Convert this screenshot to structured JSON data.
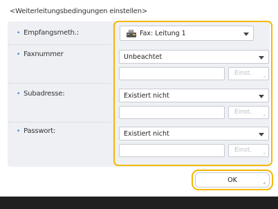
{
  "heading": "<Weiterleitungsbedingungen einstellen>",
  "rows": {
    "receive_method": {
      "label": "Empfangsmeth.:",
      "value": "Fax: Leitung 1",
      "icon": "fax-icon"
    },
    "fax_number": {
      "label": "Faxnummer",
      "value": "Unbeachtet",
      "input_value": "",
      "button_label": "Einst."
    },
    "subaddress": {
      "label": "Subadresse:",
      "value": "Existiert nicht",
      "input_value": "",
      "button_label": "Einst."
    },
    "password": {
      "label": "Passwort:",
      "value": "Existiert nicht",
      "input_value": "",
      "button_label": "Einst."
    }
  },
  "ok_label": "OK",
  "colors": {
    "focus_outline": "#f5b700",
    "panel_bg": "#eef0f4",
    "bottom_bar": "#1f1f1f"
  }
}
